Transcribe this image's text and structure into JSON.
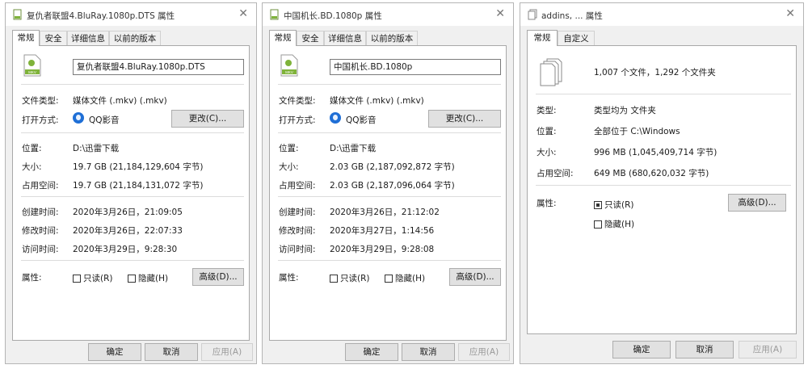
{
  "dialog1": {
    "title": "复仇者联盟4.BluRay.1080p.DTS 属性",
    "tabs": [
      "常规",
      "安全",
      "详细信息",
      "以前的版本"
    ],
    "file_name": "复仇者联盟4.BluRay.1080p.DTS",
    "labels": {
      "file_type": "文件类型:",
      "open_with": "打开方式:",
      "location": "位置:",
      "size": "大小:",
      "size_on_disk": "占用空间:",
      "created": "创建时间:",
      "modified": "修改时间:",
      "accessed": "访问时间:",
      "attributes": "属性:"
    },
    "file_type": "媒体文件 (.mkv) (.mkv)",
    "open_with_app": "QQ影音",
    "change_label": "更改(C)...",
    "location": "D:\\迅雷下载",
    "size": "19.7 GB (21,184,129,604 字节)",
    "size_on_disk": "19.7 GB (21,184,131,072 字节)",
    "created": "2020年3月26日，21:09:05",
    "modified": "2020年3月26日，22:07:33",
    "accessed": "2020年3月29日，9:28:30",
    "readonly_label": "只读(R)",
    "hidden_label": "隐藏(H)",
    "advanced_label": "高级(D)...",
    "ok_label": "确定",
    "cancel_label": "取消",
    "apply_label": "应用(A)"
  },
  "dialog2": {
    "title": "中国机长.BD.1080p 属性",
    "tabs": [
      "常规",
      "安全",
      "详细信息",
      "以前的版本"
    ],
    "file_name": "中国机长.BD.1080p",
    "labels": {
      "file_type": "文件类型:",
      "open_with": "打开方式:",
      "location": "位置:",
      "size": "大小:",
      "size_on_disk": "占用空间:",
      "created": "创建时间:",
      "modified": "修改时间:",
      "accessed": "访问时间:",
      "attributes": "属性:"
    },
    "file_type": "媒体文件 (.mkv) (.mkv)",
    "open_with_app": "QQ影音",
    "change_label": "更改(C)...",
    "location": "D:\\迅雷下载",
    "size": "2.03 GB (2,187,092,872 字节)",
    "size_on_disk": "2.03 GB (2,187,096,064 字节)",
    "created": "2020年3月26日，21:12:02",
    "modified": "2020年3月27日，1:14:56",
    "accessed": "2020年3月29日，9:28:08",
    "readonly_label": "只读(R)",
    "hidden_label": "隐藏(H)",
    "advanced_label": "高级(D)...",
    "ok_label": "确定",
    "cancel_label": "取消",
    "apply_label": "应用(A)"
  },
  "dialog3": {
    "title": "addins, ... 属性",
    "tabs": [
      "常规",
      "自定义"
    ],
    "summary": "1,007 个文件，1,292 个文件夹",
    "labels": {
      "type": "类型:",
      "location": "位置:",
      "size": "大小:",
      "size_on_disk": "占用空间:",
      "attributes": "属性:"
    },
    "type": "类型均为 文件夹",
    "location": "全部位于 C:\\Windows",
    "size": "996 MB (1,045,409,714 字节)",
    "size_on_disk": "649 MB (680,620,032 字节)",
    "readonly_label": "只读(R)",
    "hidden_label": "隐藏(H)",
    "advanced_label": "高级(D)...",
    "ok_label": "确定",
    "cancel_label": "取消",
    "apply_label": "应用(A)"
  },
  "icons": {
    "window": "properties-window-icon",
    "file": "mkv-file-icon",
    "app": "qq-player-icon",
    "multi_file": "multiple-files-icon",
    "close": "close-icon"
  }
}
